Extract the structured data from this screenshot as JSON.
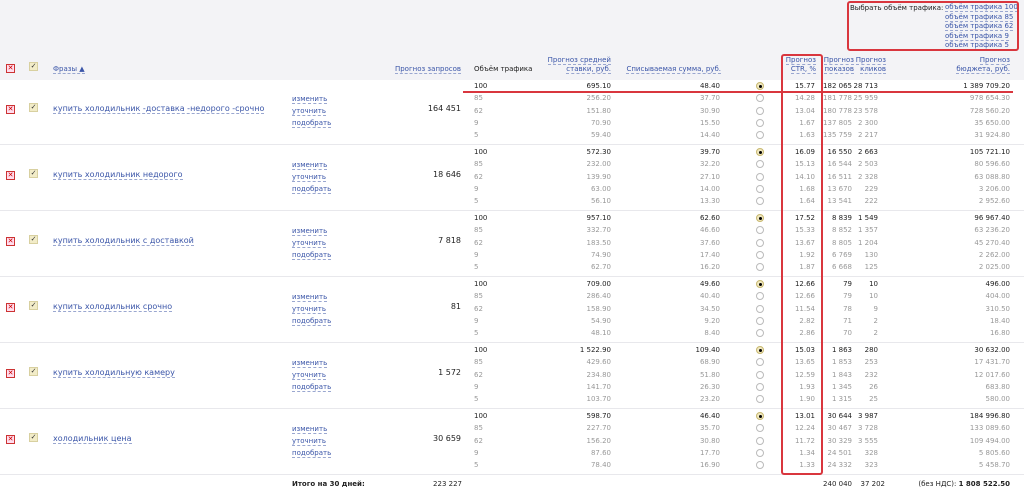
{
  "traffic_selector": {
    "label": "Выбрать объём трафика:",
    "options": [
      "объём трафика 100",
      "объём трафика 85",
      "объём трафика 62",
      "объём трафика 9",
      "объём трафика 5"
    ]
  },
  "headers": {
    "phrases": "Фразы ▲",
    "requests": "Прогноз запросов",
    "traffic": "Объём трафика",
    "avg_bid": [
      "Прогноз средней",
      "ставки, руб."
    ],
    "charge": "Списываемая сумма, руб.",
    "ctr": [
      "Прогноз",
      "CTR, %"
    ],
    "shows": [
      "Прогноз",
      "показов"
    ],
    "clicks": [
      "Прогноз",
      "кликов"
    ],
    "budget": [
      "Прогноз",
      "бюджета, руб."
    ]
  },
  "actions": [
    "изменить",
    "уточнить",
    "подобрать"
  ],
  "groups": [
    {
      "phrase": "купить холодильник -доставка -недорого -срочно",
      "requests": "164 451",
      "rows": [
        [
          "100",
          "695.10",
          "48.40",
          "15.77",
          "182 065",
          "28 713",
          "1 389 709.20"
        ],
        [
          "85",
          "256.20",
          "37.70",
          "14.28",
          "181 778",
          "25 959",
          "978 654.30"
        ],
        [
          "62",
          "151.80",
          "30.90",
          "13.04",
          "180 778",
          "23 578",
          "728 560.20"
        ],
        [
          "9",
          "70.90",
          "15.50",
          "1.67",
          "137 805",
          "2 300",
          "35 650.00"
        ],
        [
          "5",
          "59.40",
          "14.40",
          "1.63",
          "135 759",
          "2 217",
          "31 924.80"
        ]
      ]
    },
    {
      "phrase": "купить холодильник недорого",
      "requests": "18 646",
      "rows": [
        [
          "100",
          "572.30",
          "39.70",
          "16.09",
          "16 550",
          "2 663",
          "105 721.10"
        ],
        [
          "85",
          "232.00",
          "32.20",
          "15.13",
          "16 544",
          "2 503",
          "80 596.60"
        ],
        [
          "62",
          "139.90",
          "27.10",
          "14.10",
          "16 511",
          "2 328",
          "63 088.80"
        ],
        [
          "9",
          "63.00",
          "14.00",
          "1.68",
          "13 670",
          "229",
          "3 206.00"
        ],
        [
          "5",
          "56.10",
          "13.30",
          "1.64",
          "13 541",
          "222",
          "2 952.60"
        ]
      ]
    },
    {
      "phrase": "купить холодильник с доставкой",
      "requests": "7 818",
      "rows": [
        [
          "100",
          "957.10",
          "62.60",
          "17.52",
          "8 839",
          "1 549",
          "96 967.40"
        ],
        [
          "85",
          "332.70",
          "46.60",
          "15.33",
          "8 852",
          "1 357",
          "63 236.20"
        ],
        [
          "62",
          "183.50",
          "37.60",
          "13.67",
          "8 805",
          "1 204",
          "45 270.40"
        ],
        [
          "9",
          "74.90",
          "17.40",
          "1.92",
          "6 769",
          "130",
          "2 262.00"
        ],
        [
          "5",
          "62.70",
          "16.20",
          "1.87",
          "6 668",
          "125",
          "2 025.00"
        ]
      ]
    },
    {
      "phrase": "купить холодильник срочно",
      "requests": "81",
      "rows": [
        [
          "100",
          "709.00",
          "49.60",
          "12.66",
          "79",
          "10",
          "496.00"
        ],
        [
          "85",
          "286.40",
          "40.40",
          "12.66",
          "79",
          "10",
          "404.00"
        ],
        [
          "62",
          "158.90",
          "34.50",
          "11.54",
          "78",
          "9",
          "310.50"
        ],
        [
          "9",
          "54.90",
          "9.20",
          "2.82",
          "71",
          "2",
          "18.40"
        ],
        [
          "5",
          "48.10",
          "8.40",
          "2.86",
          "70",
          "2",
          "16.80"
        ]
      ]
    },
    {
      "phrase": "купить холодильную камеру",
      "requests": "1 572",
      "rows": [
        [
          "100",
          "1 522.90",
          "109.40",
          "15.03",
          "1 863",
          "280",
          "30 632.00"
        ],
        [
          "85",
          "429.60",
          "68.90",
          "13.65",
          "1 853",
          "253",
          "17 431.70"
        ],
        [
          "62",
          "234.80",
          "51.80",
          "12.59",
          "1 843",
          "232",
          "12 017.60"
        ],
        [
          "9",
          "141.70",
          "26.30",
          "1.93",
          "1 345",
          "26",
          "683.80"
        ],
        [
          "5",
          "103.70",
          "23.20",
          "1.90",
          "1 315",
          "25",
          "580.00"
        ]
      ]
    },
    {
      "phrase": "холодильник цена",
      "requests": "30 659",
      "rows": [
        [
          "100",
          "598.70",
          "46.40",
          "13.01",
          "30 644",
          "3 987",
          "184 996.80"
        ],
        [
          "85",
          "227.70",
          "35.70",
          "12.24",
          "30 467",
          "3 728",
          "133 089.60"
        ],
        [
          "62",
          "156.20",
          "30.80",
          "11.72",
          "30 329",
          "3 555",
          "109 494.00"
        ],
        [
          "9",
          "87.60",
          "17.70",
          "1.34",
          "24 501",
          "328",
          "5 805.60"
        ],
        [
          "5",
          "78.40",
          "16.90",
          "1.33",
          "24 332",
          "323",
          "5 458.70"
        ]
      ]
    }
  ],
  "totals": {
    "label": "Итого на 30 дней:",
    "requests": "223 227",
    "shows": "240 040",
    "clicks": "37 202",
    "budget_label": "(без НДС):",
    "budget": "1 808 522.50"
  },
  "colors": {
    "accent": "#d9363e",
    "link": "#3a55a8"
  }
}
